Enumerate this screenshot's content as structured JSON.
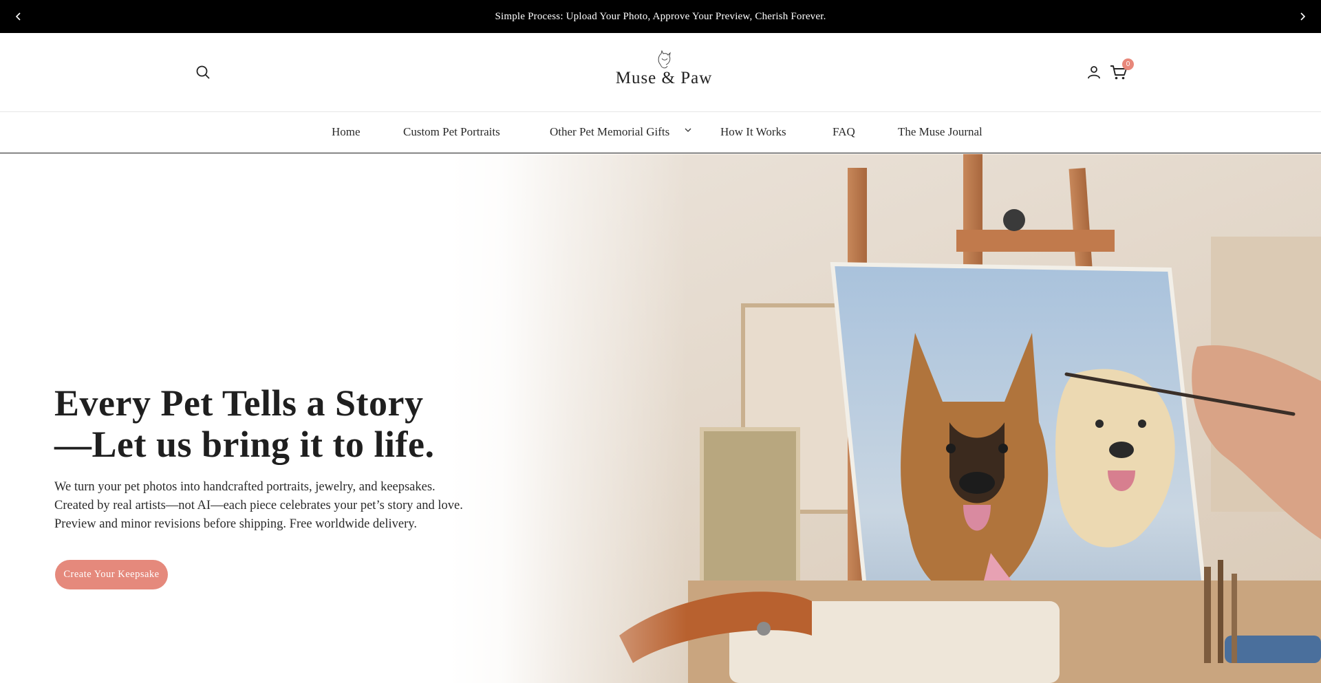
{
  "announcement": {
    "text": "Simple Process: Upload Your Photo, Approve Your Preview, Cherish Forever.",
    "prev_icon": "chevron-left-icon",
    "next_icon": "chevron-right-icon"
  },
  "header": {
    "logo_text": "Muse & Paw",
    "search_icon": "search-icon",
    "account_icon": "user-icon",
    "cart_icon": "cart-icon",
    "cart_count": "0"
  },
  "nav": {
    "items": [
      {
        "label": "Home"
      },
      {
        "label": "Custom Pet Portraits"
      },
      {
        "label": "Other Pet Memorial Gifts",
        "has_dropdown": true
      },
      {
        "label": "How It Works"
      },
      {
        "label": "FAQ"
      },
      {
        "label": "The Muse Journal"
      }
    ]
  },
  "hero": {
    "title_line1": "Every Pet Tells a Story",
    "title_line2": "—Let us bring it to life.",
    "subtitle_line1": "We turn your pet photos into handcrafted portraits, jewelry, and keepsakes.",
    "subtitle_line2": "Created by real artists—not AI—each piece celebrates your pet’s story and love.",
    "subtitle_line3": "Preview and minor revisions before shipping. Free worldwide delivery.",
    "cta_label": "Create Your Keepsake"
  },
  "colors": {
    "announcement_bg": "#000000",
    "accent": "#e5897c",
    "text": "#1e1e1e"
  }
}
